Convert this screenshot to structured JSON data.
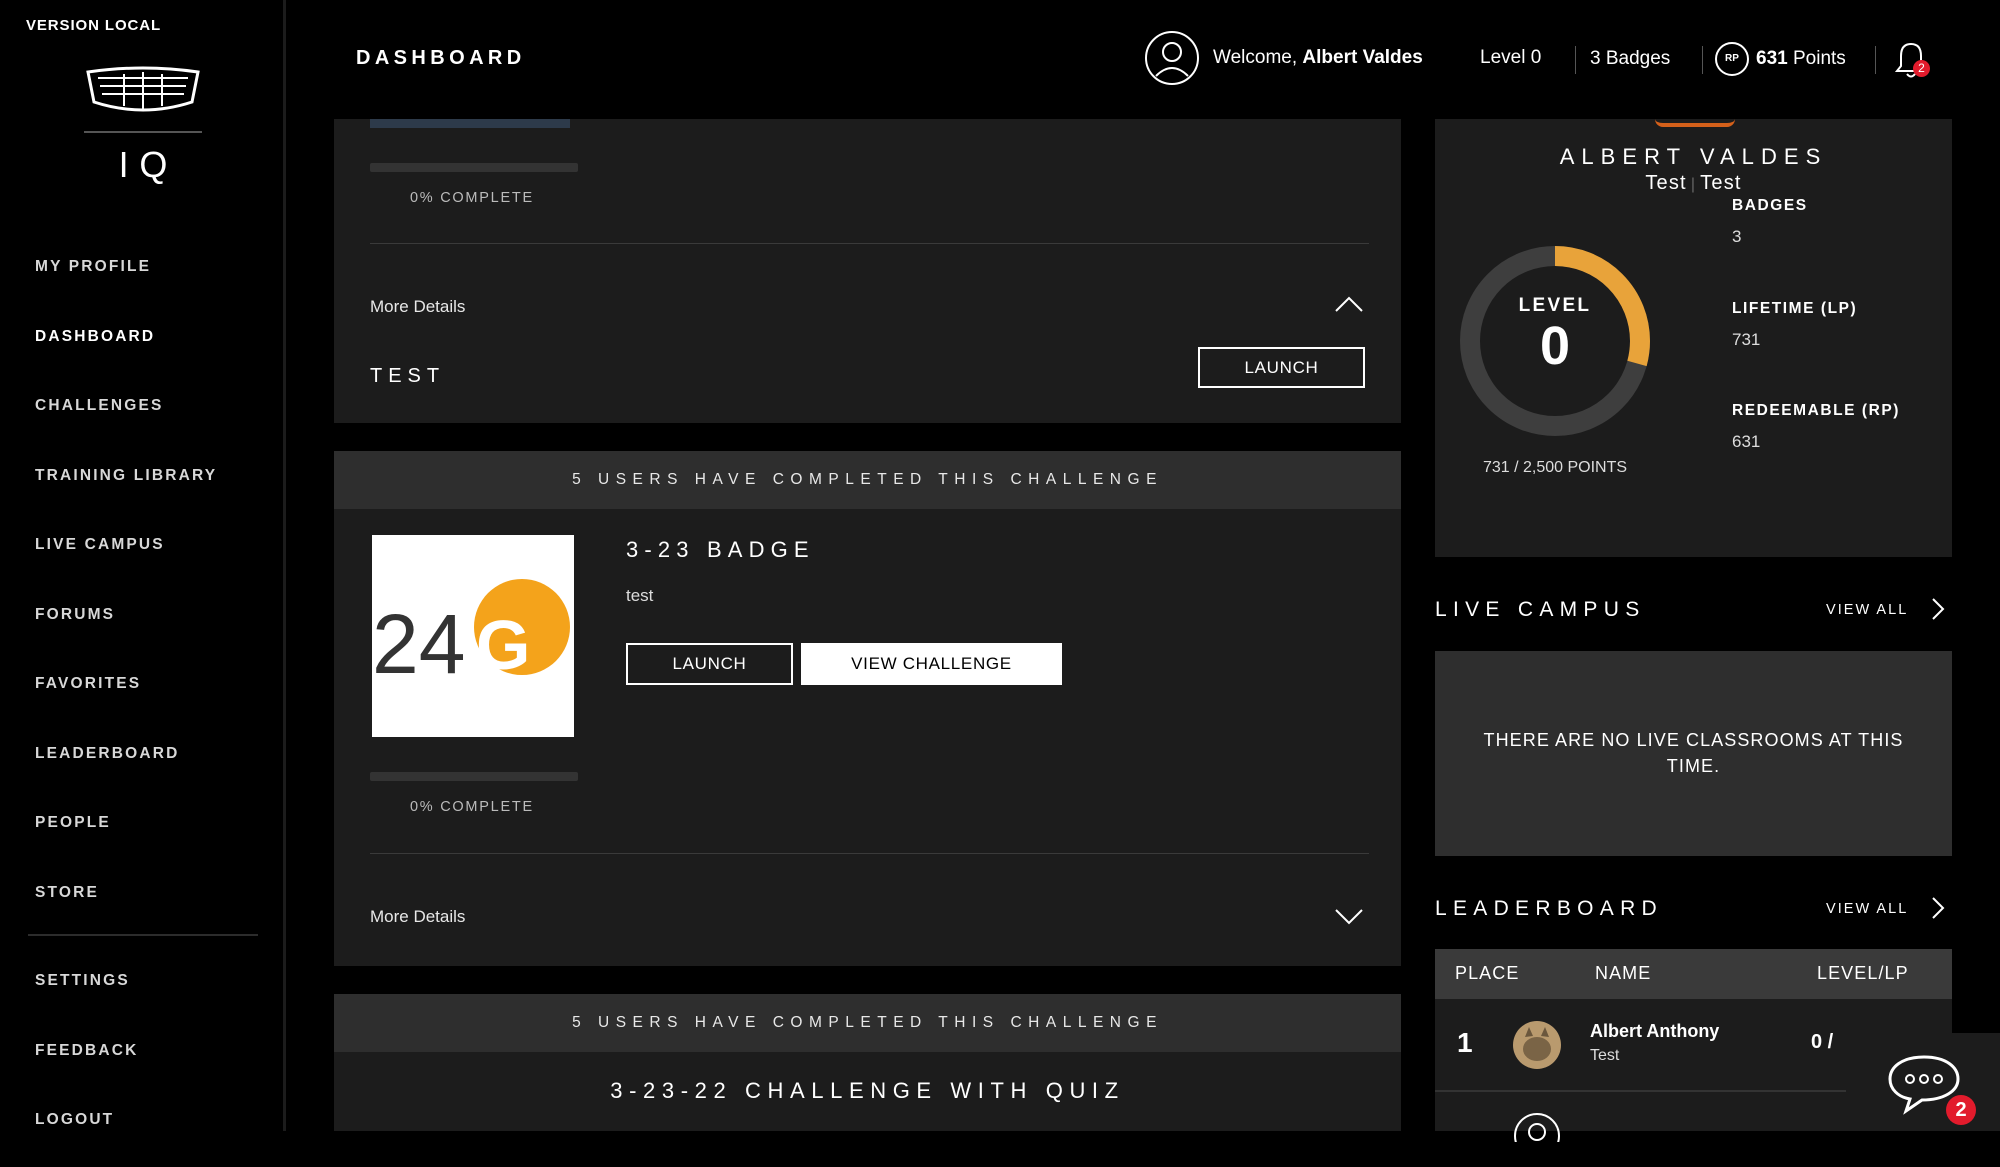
{
  "sidebar": {
    "version_label": "VERSION LOCAL",
    "logo_text": "IQ",
    "items": [
      {
        "label": "MY PROFILE"
      },
      {
        "label": "DASHBOARD",
        "active": true
      },
      {
        "label": "CHALLENGES"
      },
      {
        "label": "TRAINING LIBRARY"
      },
      {
        "label": "LIVE CAMPUS"
      },
      {
        "label": "FORUMS"
      },
      {
        "label": "FAVORITES"
      },
      {
        "label": "LEADERBOARD"
      },
      {
        "label": "PEOPLE"
      },
      {
        "label": "STORE"
      }
    ],
    "secondary_items": [
      {
        "label": "SETTINGS"
      },
      {
        "label": "FEEDBACK"
      },
      {
        "label": "LOGOUT"
      }
    ]
  },
  "header": {
    "title": "DASHBOARD",
    "welcome_prefix": "Welcome,",
    "user_name": "Albert Valdes",
    "level": "Level 0",
    "badges": "3 Badges",
    "rp_icon_label": "RP",
    "points_value": "631",
    "points_suffix": "Points",
    "notification_count": "2"
  },
  "challenges": {
    "card1": {
      "percent_complete": "0% COMPLETE",
      "more_details": "More Details",
      "title": "TEST",
      "launch_label": "LAUNCH"
    },
    "card2": {
      "completed_banner": "5 USERS HAVE COMPLETED THIS CHALLENGE",
      "badge_logo_text": "24G",
      "title": "3-23 BADGE",
      "description": "test",
      "launch_label": "LAUNCH",
      "view_label": "VIEW CHALLENGE",
      "percent_complete": "0% COMPLETE",
      "more_details": "More Details"
    },
    "card3": {
      "completed_banner": "5 USERS HAVE COMPLETED THIS CHALLENGE",
      "title": "3-23-22 CHALLENGE WITH QUIZ"
    }
  },
  "profile": {
    "name": "ALBERT VALDES",
    "subtitle_left": "Test",
    "subtitle_right": "Test",
    "level_label": "LEVEL",
    "level_value": "0",
    "points_text": "731 / 2,500 POINTS",
    "points_current": 731,
    "points_max": 2500,
    "badges_label": "BADGES",
    "badges_value": "3",
    "lifetime_label": "LIFETIME (LP)",
    "lifetime_value": "731",
    "redeemable_label": "REDEEMABLE (RP)",
    "redeemable_value": "631",
    "ring_color": "#e8a33a"
  },
  "live_campus": {
    "title": "LIVE CAMPUS",
    "view_all": "VIEW ALL",
    "empty_message": "THERE ARE NO LIVE CLASSROOMS AT THIS TIME."
  },
  "leaderboard": {
    "title": "LEADERBOARD",
    "view_all": "VIEW ALL",
    "columns": [
      "PLACE",
      "NAME",
      "LEVEL/LP"
    ],
    "rows": [
      {
        "place": "1",
        "name": "Albert Anthony",
        "subtitle": "Test",
        "level": "0 /"
      }
    ]
  },
  "chat": {
    "unread_count": "2"
  }
}
